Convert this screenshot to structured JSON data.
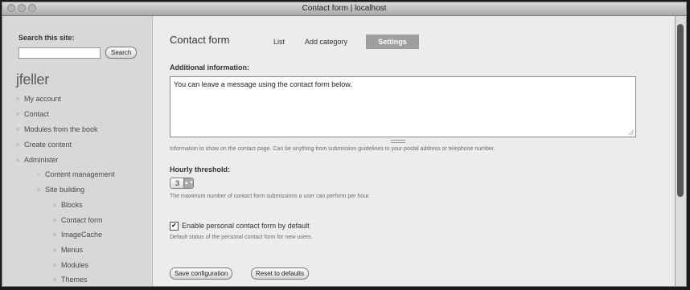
{
  "window": {
    "title": "Contact form | localhost"
  },
  "sidebar": {
    "search_label": "Search this site:",
    "search_value": "",
    "search_button": "Search",
    "username": "jfeller",
    "nav": [
      {
        "label": "My account"
      },
      {
        "label": "Contact"
      },
      {
        "label": "Modules from the book"
      },
      {
        "label": "Create content"
      },
      {
        "label": "Administer"
      },
      {
        "label": "Content management"
      },
      {
        "label": "Site building"
      },
      {
        "label": "Blocks"
      },
      {
        "label": "Contact form"
      },
      {
        "label": "ImageCache"
      },
      {
        "label": "Menus"
      },
      {
        "label": "Modules"
      },
      {
        "label": "Themes"
      }
    ]
  },
  "main": {
    "title": "Contact form",
    "tabs": {
      "list": "List",
      "add_category": "Add category",
      "settings": "Settings"
    },
    "additional_info": {
      "label": "Additional information:",
      "value": "You can leave a message using the contact form below.",
      "description": "Information to show on the contact page. Can be anything from submission guidelines to your postal address or telephone number."
    },
    "hourly_threshold": {
      "label": "Hourly threshold:",
      "value": "3",
      "description": "The maximum number of contact form submissions a user can perform per hour."
    },
    "personal_contact": {
      "checked": true,
      "label": "Enable personal contact form by default",
      "description": "Default status of the personal contact form for new users."
    },
    "buttons": {
      "save": "Save configuration",
      "reset": "Reset to defaults"
    }
  }
}
